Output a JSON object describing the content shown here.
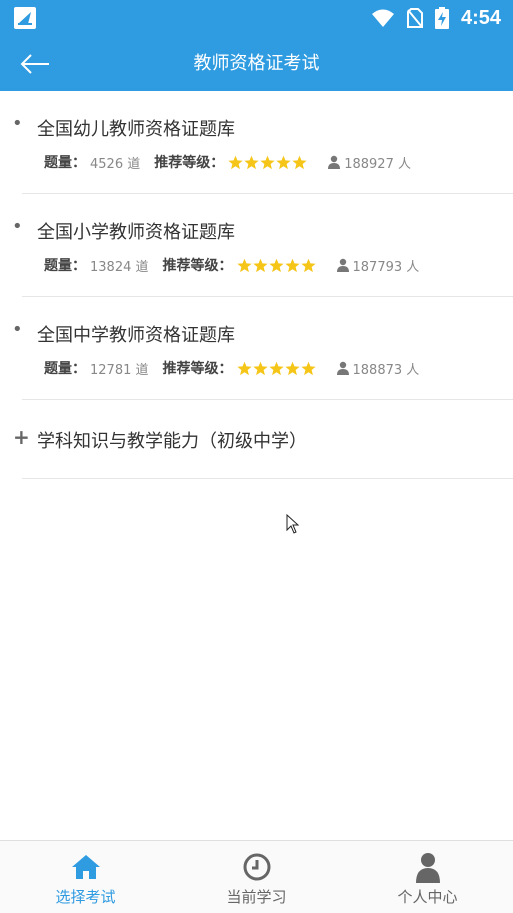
{
  "status_bar": {
    "time": "4:54"
  },
  "header": {
    "title": "教师资格证考试"
  },
  "banks": [
    {
      "title": "全国幼儿教师资格证题库",
      "count_label": "题量：",
      "count": "4526 道",
      "rating_label": "推荐等级：",
      "rating": 5,
      "users": "188927 人"
    },
    {
      "title": "全国小学教师资格证题库",
      "count_label": "题量：",
      "count": "13824 道",
      "rating_label": "推荐等级：",
      "rating": 5,
      "users": "187793 人"
    },
    {
      "title": "全国中学教师资格证题库",
      "count_label": "题量：",
      "count": "12781 道",
      "rating_label": "推荐等级：",
      "rating": 5,
      "users": "188873 人"
    }
  ],
  "expandable": {
    "title": "学科知识与教学能力（初级中学）"
  },
  "tabs": [
    {
      "label": "选择考试",
      "icon": "home-icon",
      "active": true
    },
    {
      "label": "当前学习",
      "icon": "clock-icon",
      "active": false
    },
    {
      "label": "个人中心",
      "icon": "person-icon",
      "active": false
    }
  ],
  "colors": {
    "primary": "#2f9be0",
    "star": "#f5c518",
    "text": "#333333",
    "muted": "#888888"
  }
}
